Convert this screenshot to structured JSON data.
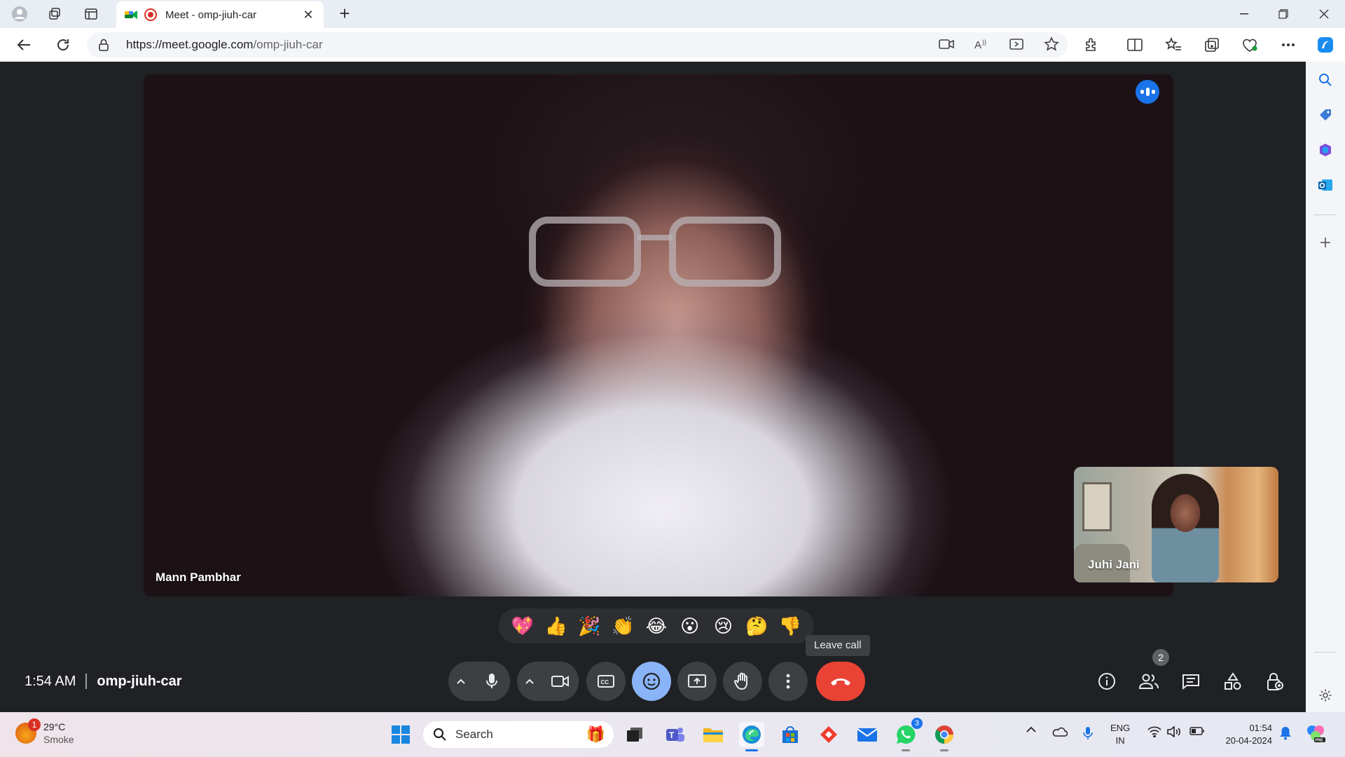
{
  "browser": {
    "tab_title": "Meet - omp-jiuh-car",
    "url_host": "https://meet.google.com",
    "url_path": "/omp-jiuh-car",
    "new_tab_label": "+"
  },
  "meeting": {
    "main_participant": "Mann Pambhar",
    "pip_participant": "Juhi Jani",
    "time": "1:54 AM",
    "code": "omp-jiuh-car",
    "participant_count": "2",
    "leave_tooltip": "Leave call",
    "reactions": [
      "💖",
      "👍",
      "🎉",
      "👏",
      "😂",
      "😮",
      "😢",
      "🤔",
      "👎"
    ]
  },
  "taskbar": {
    "weather_temp": "29°C",
    "weather_cond": "Smoke",
    "weather_badge": "1",
    "search_placeholder": "Search",
    "whatsapp_badge": "3",
    "lang_line1": "ENG",
    "lang_line2": "IN",
    "time": "01:54",
    "date": "20-04-2024"
  },
  "colors": {
    "leave_red": "#ea4335",
    "accent_blue": "#8ab4f8",
    "meet_bg": "#202124"
  }
}
